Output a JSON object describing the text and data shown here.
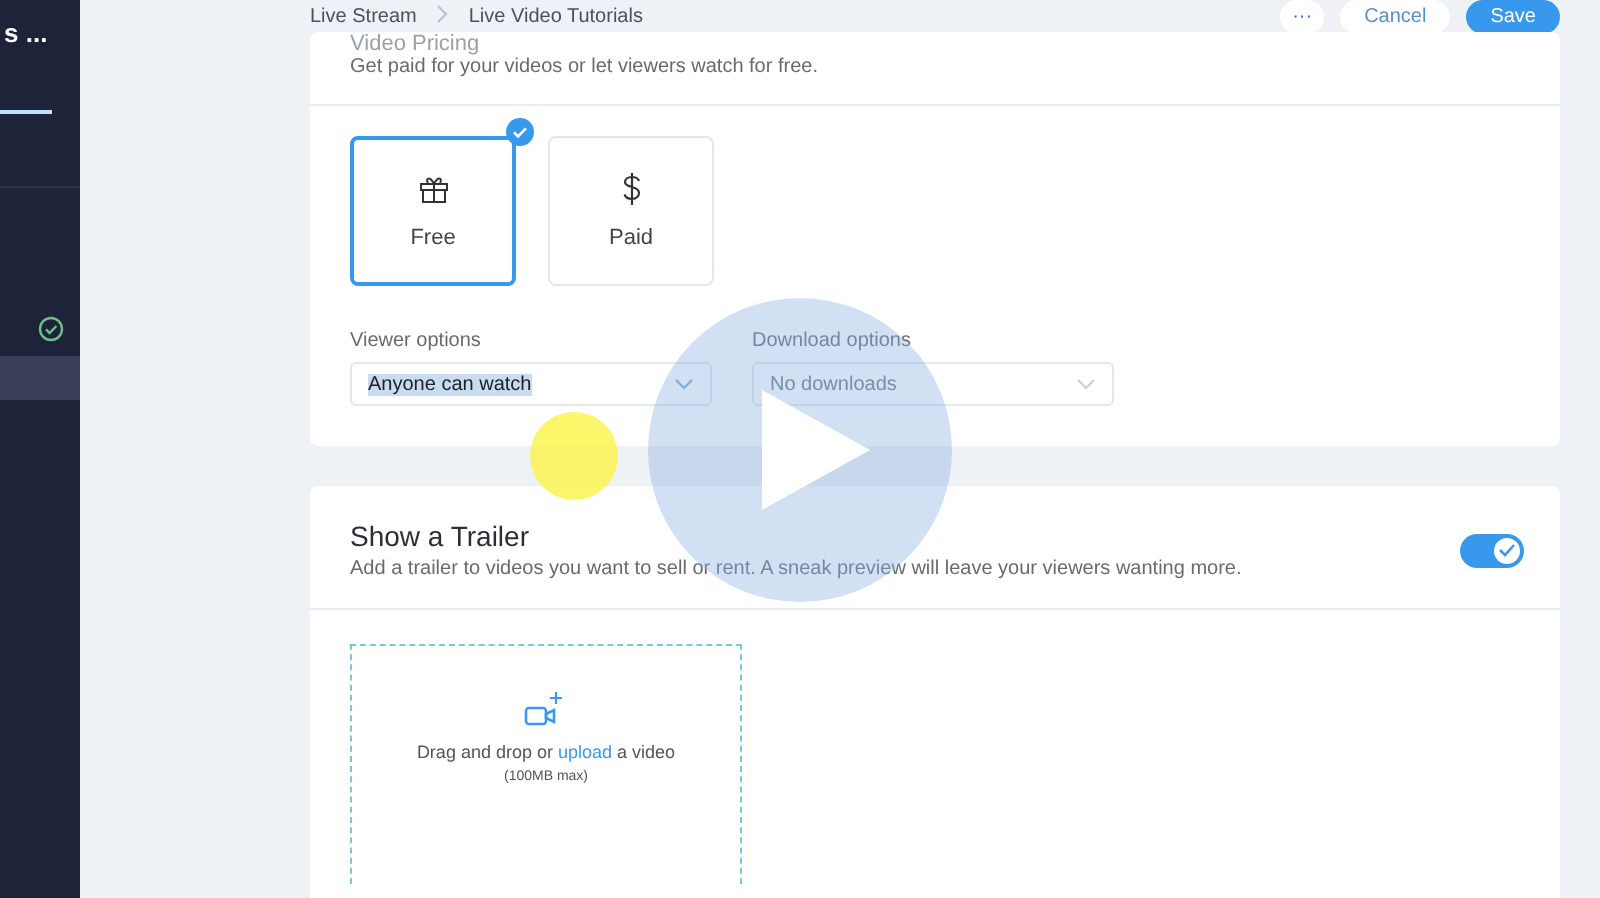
{
  "sidebar": {
    "title": "s ...",
    "items": [
      {
        "kind": "tab-line",
        "selected": true
      },
      {
        "kind": "check",
        "checked": true
      },
      {
        "kind": "row",
        "selected": true
      }
    ]
  },
  "breadcrumbs": [
    "Live Stream",
    "Live Video Tutorials"
  ],
  "actions": {
    "more": "···",
    "cancel": "Cancel",
    "save": "Save"
  },
  "pricing": {
    "title": "Video Pricing",
    "subtitle": "Get paid for your videos or let viewers watch for free.",
    "options": [
      {
        "kind": "gift",
        "label": "Free",
        "selected": true
      },
      {
        "kind": "dollar",
        "label": "Paid",
        "selected": false
      }
    ],
    "viewer_options": {
      "label": "Viewer options",
      "value": "Anyone can watch",
      "highlighted": true
    },
    "download_options": {
      "label": "Download options",
      "value": "No downloads",
      "disabled": true
    }
  },
  "trailer": {
    "title": "Show a Trailer",
    "subtitle": "Add a trailer to videos you want to sell or rent. A sneak preview will leave your viewers wanting more.",
    "on": true,
    "upload": {
      "before": "Drag and drop or ",
      "link": "upload",
      "after": " a video",
      "note": "(100MB max)"
    }
  },
  "player": {
    "paused": true
  }
}
